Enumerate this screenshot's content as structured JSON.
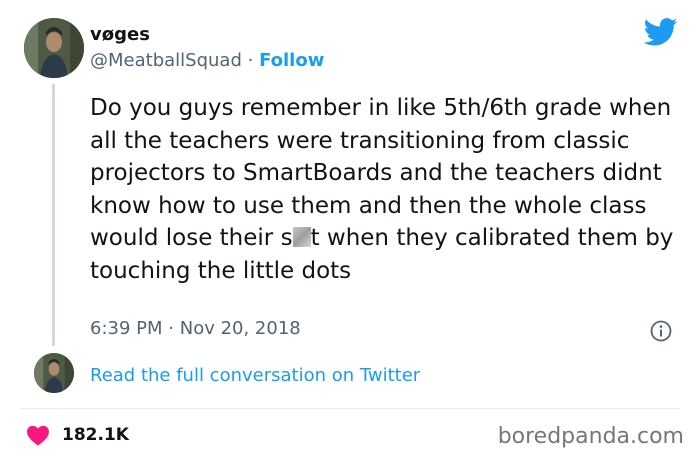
{
  "user": {
    "display_name": "vøges",
    "handle": "@MeatballSquad",
    "separator": "·",
    "follow_label": "Follow"
  },
  "tweet": {
    "text_before_censor": "Do you guys remember in like 5th/6th grade when all the teachers were transitioning from classic projectors to SmartBoards and the teachers didnt know how to use them and then the whole class would lose their s",
    "text_after_censor": "t when they calibrated them by touching the little dots",
    "time": "6:39 PM",
    "date_separator": "·",
    "date": "Nov 20, 2018"
  },
  "conversation": {
    "link_label": "Read the full conversation on Twitter"
  },
  "stats": {
    "likes": "182.1K"
  },
  "watermark": "boredpanda.com",
  "colors": {
    "twitter_blue": "#1d9bf0",
    "heart_red": "#f91880",
    "secondary_text": "#536471"
  },
  "icons": [
    "twitter-bird-icon",
    "info-icon",
    "heart-icon"
  ]
}
